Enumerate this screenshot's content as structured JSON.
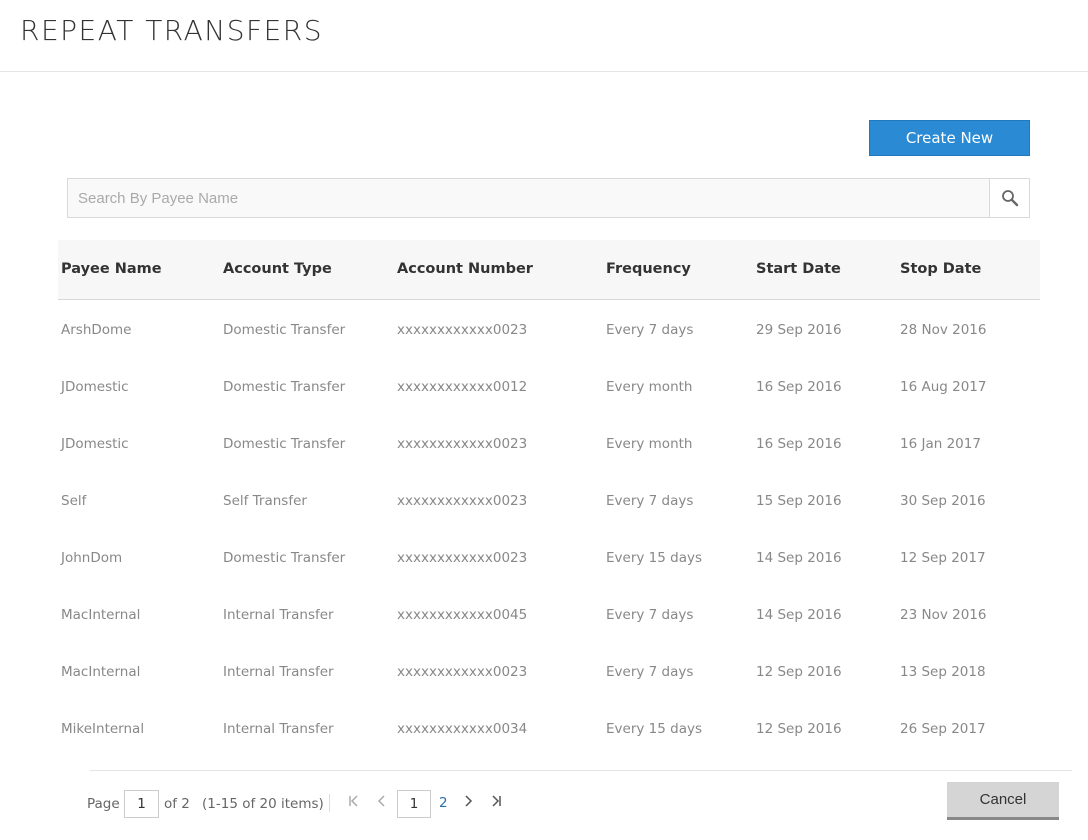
{
  "header": {
    "title": "REPEAT TRANSFERS"
  },
  "actions": {
    "create_label": "Create New",
    "cancel_label": "Cancel"
  },
  "search": {
    "placeholder": "Search By Payee Name",
    "value": ""
  },
  "table": {
    "columns": [
      "Payee Name",
      "Account Type",
      "Account Number",
      "Frequency",
      "Start Date",
      "Stop Date"
    ],
    "rows": [
      [
        "ArshDome",
        "Domestic Transfer",
        "xxxxxxxxxxxx0023",
        "Every 7 days",
        "29 Sep 2016",
        "28 Nov 2016"
      ],
      [
        "JDomestic",
        "Domestic Transfer",
        "xxxxxxxxxxxx0012",
        "Every month",
        "16 Sep 2016",
        "16 Aug 2017"
      ],
      [
        "JDomestic",
        "Domestic Transfer",
        "xxxxxxxxxxxx0023",
        "Every month",
        "16 Sep 2016",
        "16 Jan 2017"
      ],
      [
        "Self",
        "Self Transfer",
        "xxxxxxxxxxxx0023",
        "Every 7 days",
        "15 Sep 2016",
        "30 Sep 2016"
      ],
      [
        "JohnDom",
        "Domestic Transfer",
        "xxxxxxxxxxxx0023",
        "Every 15 days",
        "14 Sep 2016",
        "12 Sep 2017"
      ],
      [
        "MacInternal",
        "Internal Transfer",
        "xxxxxxxxxxxx0045",
        "Every 7 days",
        "14 Sep 2016",
        "23 Nov 2016"
      ],
      [
        "MacInternal",
        "Internal Transfer",
        "xxxxxxxxxxxx0023",
        "Every 7 days",
        "12 Sep 2016",
        "13 Sep 2018"
      ],
      [
        "MikeInternal",
        "Internal Transfer",
        "xxxxxxxxxxxx0034",
        "Every 15 days",
        "12 Sep 2016",
        "26 Sep 2017"
      ]
    ]
  },
  "pagination": {
    "page_label": "Page",
    "current_page": "1",
    "of_label": "of 2",
    "range_label": "(1-15 of 20 items)",
    "pages": [
      "1",
      "2"
    ],
    "icons": {
      "first": "first-page-icon",
      "prev": "prev-page-icon",
      "next": "next-page-icon",
      "last": "last-page-icon"
    }
  },
  "colors": {
    "accent": "#2b8ad4",
    "cancel_bg": "#d5d5d5"
  }
}
